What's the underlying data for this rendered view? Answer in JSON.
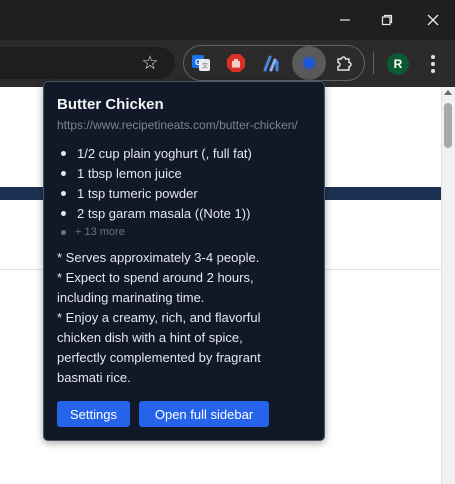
{
  "window": {
    "minimize_icon": "minimize-icon",
    "restore_icon": "restore-icon",
    "close_icon": "close-icon"
  },
  "toolbar": {
    "bookmark_icon": "star-icon",
    "extensions": [
      {
        "name": "translate-extension-icon",
        "color": "#1a73e8"
      },
      {
        "name": "adblock-extension-icon",
        "color": "#d93025"
      },
      {
        "name": "analytics-extension-icon",
        "color": "#4a86e8"
      },
      {
        "name": "recipe-extension-icon",
        "color": "#1a56db",
        "active": true
      },
      {
        "name": "puzzle-extensions-icon",
        "color": "#e3e3e3"
      }
    ],
    "avatar_letter": "R",
    "avatar_color": "#0b5a32",
    "menu_icon": "more-vert-icon"
  },
  "popup": {
    "title": "Butter Chicken",
    "url": "https://www.recipetineats.com/butter-chicken/",
    "ingredients": [
      "1/2 cup plain yoghurt (, full fat)",
      "1 tbsp lemon juice",
      "1 tsp tumeric powder",
      "2 tsp garam masala ((Note 1))"
    ],
    "more_label": "+ 13 more",
    "summary_lines": [
      "* Serves approximately 3-4 people.",
      "* Expect to spend around 2 hours,",
      "including marinating time.",
      "* Enjoy a creamy, rich, and flavorful",
      "chicken dish with a hint of spice,",
      "perfectly complemented by fragrant",
      "basmati rice."
    ],
    "settings_label": "Settings",
    "sidebar_label": "Open full sidebar"
  },
  "colors": {
    "popup_bg": "#111827",
    "button_bg": "#2563eb",
    "page_band": "#1c3152"
  }
}
